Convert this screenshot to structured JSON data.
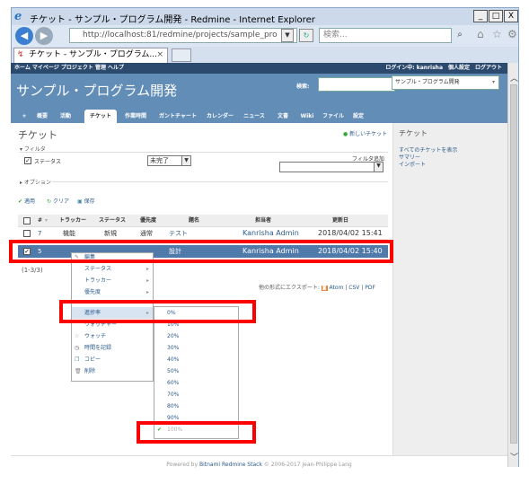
{
  "window": {
    "title": "チケット - サンプル・プログラム開発 - Redmine - Internet Explorer",
    "address": "http://localhost:81/redmine/projects/sample_pro",
    "address_host": "localhost",
    "search_placeholder": "検索...",
    "tab_title": "チケット - サンプル・プログラム...",
    "controls": [
      "_",
      "□",
      "X"
    ]
  },
  "topmenu": {
    "left": "ホーム マイページ プロジェクト 管理 ヘルプ",
    "right": "ログイン中: kanrisha　個人設定　ログアウト"
  },
  "header": {
    "title": "サンプル・プログラム開発",
    "search_label": "検索:",
    "project_select": "サンプル・プログラム開発"
  },
  "main_tabs": [
    "+",
    "概要",
    "活動",
    "チケット",
    "作業時間",
    "ガントチャート",
    "カレンダー",
    "ニュース",
    "文書",
    "Wiki",
    "ファイル",
    "設定"
  ],
  "content": {
    "page_title": "チケット",
    "new_issue": "新しいチケット",
    "filter_label": "フィルタ",
    "status_label": "ステータス",
    "status_value": "未完了",
    "add_filter": "フィルタ追加",
    "options_label": "オプション",
    "apply": "適用",
    "clear": "クリア",
    "save": "保存",
    "columns": [
      "#",
      "トラッカー",
      "ステータス",
      "優先度",
      "題名",
      "担当者",
      "更新日"
    ],
    "rows": [
      {
        "id": "7",
        "tracker": "機能",
        "status": "新規",
        "priority": "通常",
        "subject": "テスト",
        "assignee": "Kanrisha Admin",
        "updated": "2018/04/02 15:41"
      },
      {
        "id": "5",
        "tracker": "",
        "status": "",
        "priority": "",
        "subject": "設計",
        "assignee": "Kanrisha Admin",
        "updated": "2018/04/02 15:40"
      }
    ],
    "count": "(1-3/3)",
    "export_label": "他の形式にエクスポート:",
    "export_atom": "Atom",
    "export_csv": "CSV",
    "export_pdf": "PDF"
  },
  "context_menu": {
    "items": [
      "編集",
      "ステータス",
      "トラッカー",
      "優先度",
      "進捗率",
      "ウォッチャー",
      "ウォッチ",
      "時間を記録",
      "コピー",
      "削除"
    ]
  },
  "progress_submenu": [
    "0%",
    "10%",
    "20%",
    "30%",
    "40%",
    "50%",
    "60%",
    "70%",
    "80%",
    "90%",
    "100%"
  ],
  "sidebar": {
    "title": "チケット",
    "links": [
      "すべてのチケットを表示",
      "サマリー",
      "インポート"
    ]
  },
  "footer": {
    "powered_by": "Powered by",
    "product": "Bitnami Redmine Stack",
    "copyright": "© 2006-2017 Jean-Philippe Lang"
  },
  "colors": {
    "header_bg": "#628db6",
    "topmenu_bg": "#2c4a6e",
    "selected_row": "#507aaa",
    "highlight_red": "#ff0000"
  }
}
